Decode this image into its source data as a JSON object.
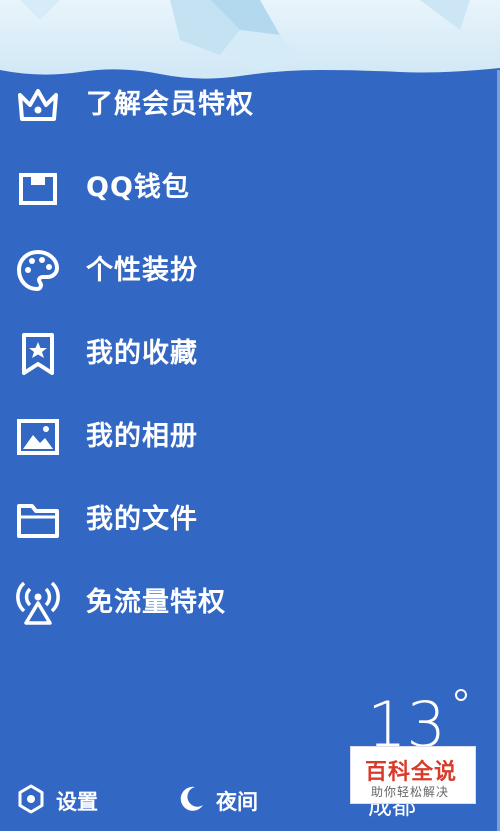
{
  "menu": {
    "items": [
      {
        "label": "了解会员特权",
        "icon": "crown-icon"
      },
      {
        "label": "QQ钱包",
        "icon": "wallet-icon"
      },
      {
        "label": "个性装扮",
        "icon": "palette-icon"
      },
      {
        "label": "我的收藏",
        "icon": "bookmark-star-icon"
      },
      {
        "label": "我的相册",
        "icon": "photo-icon"
      },
      {
        "label": "我的文件",
        "icon": "folder-icon"
      },
      {
        "label": "免流量特权",
        "icon": "broadcast-icon"
      }
    ]
  },
  "weather": {
    "temperature": "13",
    "city": "成都"
  },
  "bottom_bar": {
    "settings_label": "设置",
    "night_label": "夜间"
  },
  "watermark": {
    "title": "百科全说",
    "subtitle": "助你轻松解决"
  },
  "colors": {
    "background": "#3367c4",
    "text": "#ffffff",
    "watermark_red": "#d93a2a"
  }
}
